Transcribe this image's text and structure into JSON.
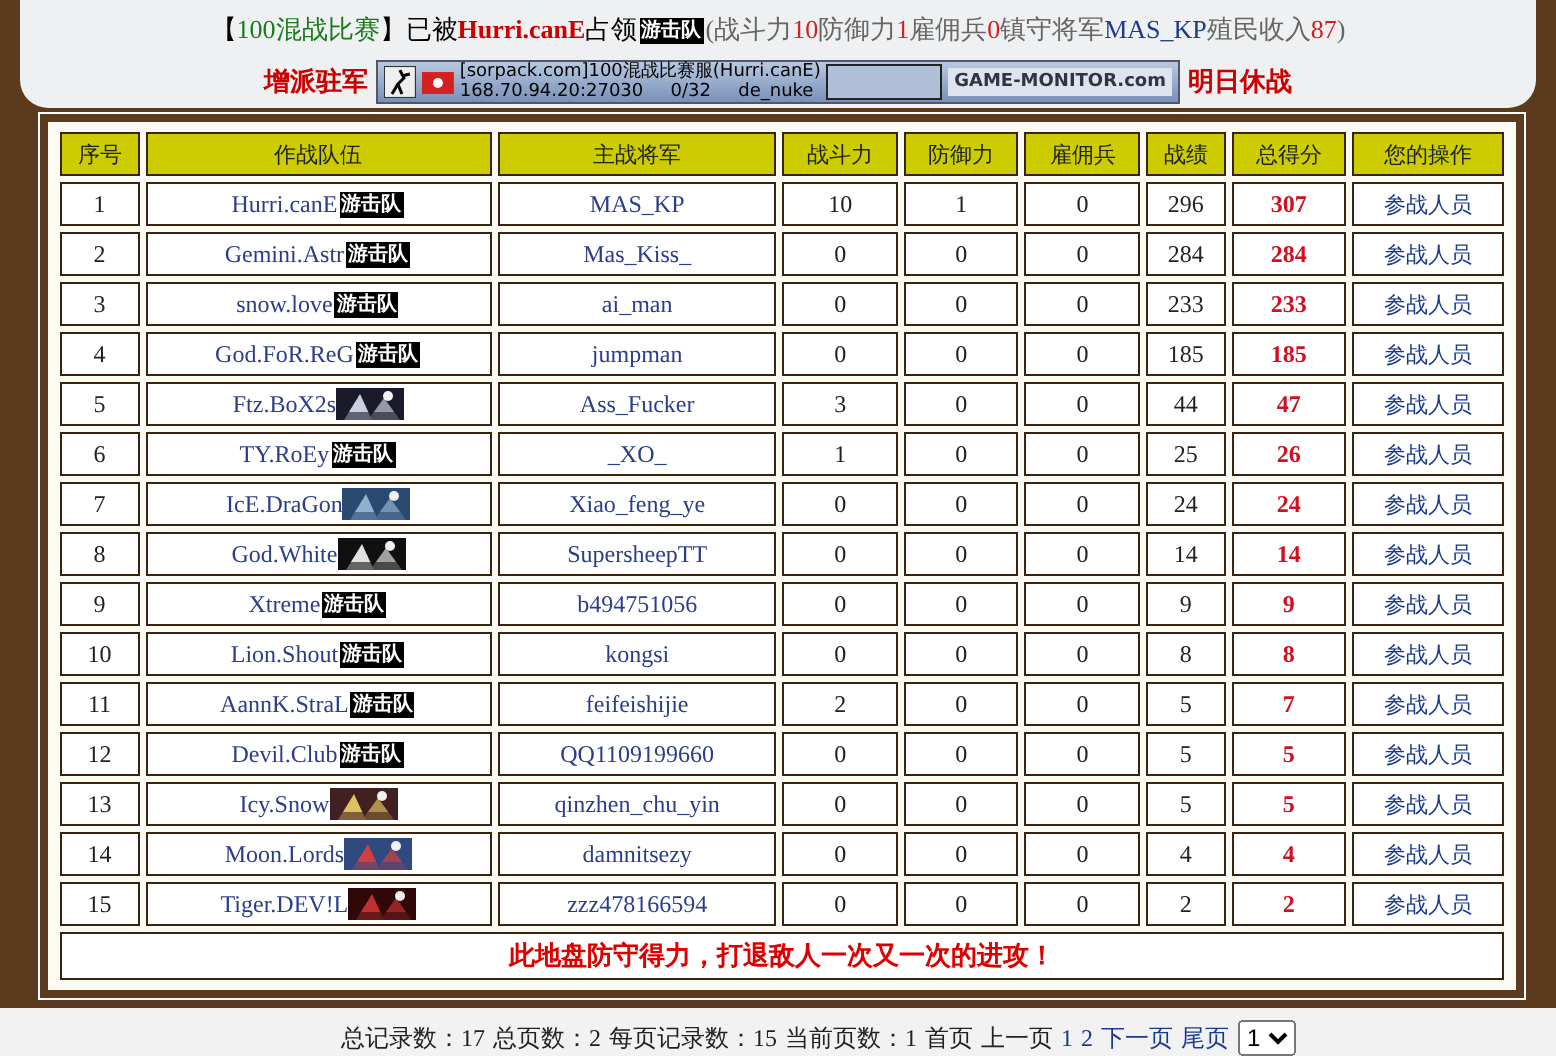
{
  "header": {
    "segments": [
      {
        "text": "【",
        "kind": "plain"
      },
      {
        "text": "100混战比赛",
        "kind": "green"
      },
      {
        "text": "】已被",
        "kind": "plain"
      },
      {
        "text": "Hurri.canE",
        "kind": "red"
      },
      {
        "text": "占领",
        "kind": "plain"
      },
      {
        "text": "游击队",
        "kind": "badge"
      },
      {
        "text": "(战斗力",
        "kind": "muted"
      },
      {
        "text": "10",
        "kind": "number"
      },
      {
        "text": "防御力",
        "kind": "muted"
      },
      {
        "text": "1",
        "kind": "number"
      },
      {
        "text": "雇佣兵",
        "kind": "muted"
      },
      {
        "text": "0",
        "kind": "number"
      },
      {
        "text": "镇守将军",
        "kind": "muted"
      },
      {
        "text": "MAS_KP",
        "kind": "blue"
      },
      {
        "text": "殖民收入",
        "kind": "muted"
      },
      {
        "text": "87",
        "kind": "number"
      },
      {
        "text": ")",
        "kind": "muted"
      }
    ]
  },
  "reinforce_label": "增派驻军",
  "server_banner": {
    "name": "[sorpack.com]100混战比赛服(Hurri.canE)",
    "address": "168.70.94.20:27030",
    "players": "0/32",
    "map": "de_nuke",
    "monitor_logo": "GAME-MONITOR.com"
  },
  "truce_label": "明日休战",
  "table": {
    "columns": [
      "序号",
      "作战队伍",
      "主战将军",
      "战斗力",
      "防御力",
      "雇佣兵",
      "战绩",
      "总得分",
      "您的操作"
    ],
    "rows": [
      {
        "no": "1",
        "team": "Hurri.canE",
        "badge": {
          "kind": "tag",
          "text": "游击队"
        },
        "general": "MAS_KP",
        "attack": "10",
        "defense": "1",
        "mercenaries": "0",
        "record": "296",
        "total": "307",
        "action": "参战人员"
      },
      {
        "no": "2",
        "team": "Gemini.Astr",
        "badge": {
          "kind": "tag",
          "text": "游击队"
        },
        "general": "Mas_Kiss_",
        "attack": "0",
        "defense": "0",
        "mercenaries": "0",
        "record": "284",
        "total": "284",
        "action": "参战人员"
      },
      {
        "no": "3",
        "team": "snow.love",
        "badge": {
          "kind": "tag",
          "text": "游击队"
        },
        "general": "ai_man",
        "attack": "0",
        "defense": "0",
        "mercenaries": "0",
        "record": "233",
        "total": "233",
        "action": "参战人员"
      },
      {
        "no": "4",
        "team": "God.FoR.ReG",
        "badge": {
          "kind": "tag",
          "text": "游击队"
        },
        "general": "jumpman",
        "attack": "0",
        "defense": "0",
        "mercenaries": "0",
        "record": "185",
        "total": "185",
        "action": "参战人员"
      },
      {
        "no": "5",
        "team": "Ftz.BoX2s",
        "general": "Ass_Fucker",
        "attack": "3",
        "defense": "0",
        "mercenaries": "0",
        "record": "44",
        "total": "47",
        "action": "参战人员"
      },
      {
        "no": "6",
        "team": "TY.RoEy",
        "badge": {
          "kind": "tag",
          "text": "游击队"
        },
        "general": "_XO_",
        "attack": "1",
        "defense": "0",
        "mercenaries": "0",
        "record": "25",
        "total": "26",
        "action": "参战人员"
      },
      {
        "no": "7",
        "team": "IcE.DraGon",
        "general": "Xiao_feng_ye",
        "attack": "0",
        "defense": "0",
        "mercenaries": "0",
        "record": "24",
        "total": "24",
        "action": "参战人员"
      },
      {
        "no": "8",
        "team": "God.White",
        "general": "SupersheepTT",
        "attack": "0",
        "defense": "0",
        "mercenaries": "0",
        "record": "14",
        "total": "14",
        "action": "参战人员"
      },
      {
        "no": "9",
        "team": "Xtreme",
        "badge": {
          "kind": "tag",
          "text": "游击队"
        },
        "general": "b494751056",
        "attack": "0",
        "defense": "0",
        "mercenaries": "0",
        "record": "9",
        "total": "9",
        "action": "参战人员"
      },
      {
        "no": "10",
        "team": "Lion.Shout",
        "badge": {
          "kind": "tag",
          "text": "游击队"
        },
        "general": "kongsi",
        "attack": "0",
        "defense": "0",
        "mercenaries": "0",
        "record": "8",
        "total": "8",
        "action": "参战人员"
      },
      {
        "no": "11",
        "team": "AannK.StraL",
        "badge": {
          "kind": "tag",
          "text": "游击队"
        },
        "general": "feifeishijie",
        "attack": "2",
        "defense": "0",
        "mercenaries": "0",
        "record": "5",
        "total": "7",
        "action": "参战人员"
      },
      {
        "no": "12",
        "team": "Devil.Club",
        "badge": {
          "kind": "tag",
          "text": "游击队"
        },
        "general": "QQ1109199660",
        "attack": "0",
        "defense": "0",
        "mercenaries": "0",
        "record": "5",
        "total": "5",
        "action": "参战人员"
      },
      {
        "no": "13",
        "team": "Icy.Snow",
        "general": "qinzhen_chu_yin",
        "attack": "0",
        "defense": "0",
        "mercenaries": "0",
        "record": "5",
        "total": "5",
        "action": "参战人员"
      },
      {
        "no": "14",
        "team": "Moon.Lords",
        "general": "damnitsezy",
        "attack": "0",
        "defense": "0",
        "mercenaries": "0",
        "record": "4",
        "total": "4",
        "action": "参战人员"
      },
      {
        "no": "15",
        "team": "Tiger.DEV!L",
        "general": "zzz478166594",
        "attack": "0",
        "defense": "0",
        "mercenaries": "0",
        "record": "2",
        "total": "2",
        "action": "参战人员"
      }
    ],
    "footer_message": "此地盘防守得力，打退敌人一次又一次的进攻！"
  },
  "pager": {
    "stats": [
      {
        "label": "总记录数：",
        "value": "17"
      },
      {
        "label": "总页数：",
        "value": "2"
      },
      {
        "label": "每页记录数：",
        "value": "15"
      },
      {
        "label": "当前页数：",
        "value": "1"
      }
    ],
    "links": [
      {
        "label": "首页",
        "disabled": true
      },
      {
        "label": "上一页",
        "disabled": true
      },
      {
        "label": "1",
        "disabled": false
      },
      {
        "label": "2",
        "disabled": false
      },
      {
        "label": "下一页",
        "disabled": false
      },
      {
        "label": "尾页",
        "disabled": false
      }
    ],
    "page_select": "1"
  }
}
